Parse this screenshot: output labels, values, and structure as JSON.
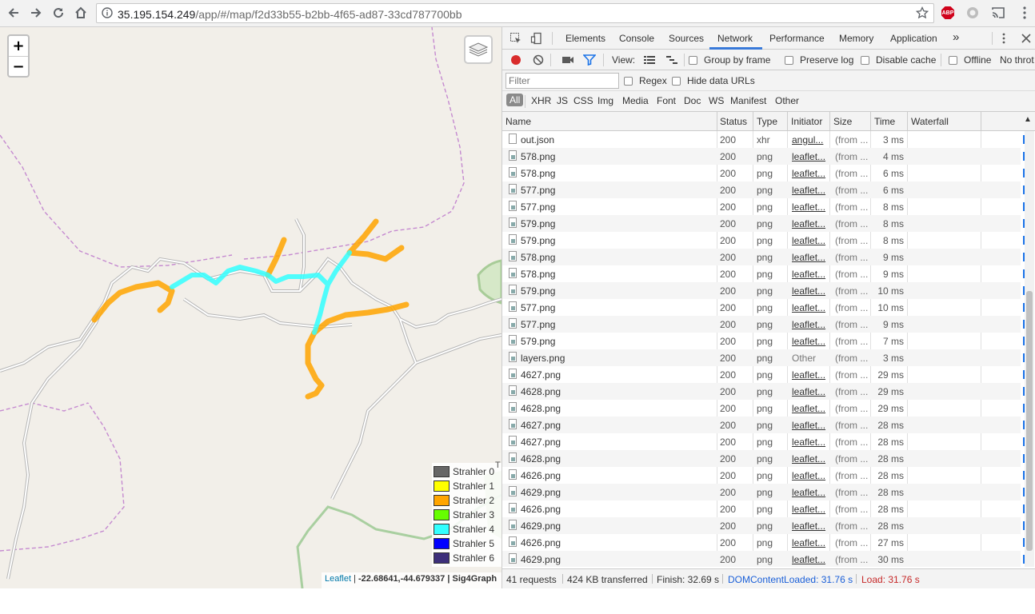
{
  "browser": {
    "url_host": "35.195.154.249",
    "url_path": "/app/#/map/f2d33b55-b2bb-4f65-ad87-33cd787700bb",
    "abp_label": "ABP"
  },
  "map": {
    "zoom_in": "+",
    "zoom_out": "−",
    "legend": [
      {
        "label": "Strahler 0",
        "color": "#666666"
      },
      {
        "label": "Strahler 1",
        "color": "#ffff00"
      },
      {
        "label": "Strahler 2",
        "color": "#ffa500"
      },
      {
        "label": "Strahler 3",
        "color": "#66ff00"
      },
      {
        "label": "Strahler 4",
        "color": "#33ffff"
      },
      {
        "label": "Strahler 5",
        "color": "#0000ff"
      },
      {
        "label": "Strahler 6",
        "color": "#3d2f7a"
      }
    ],
    "edge_label": "T",
    "attribution": {
      "leaflet": "Leaflet",
      "separator": "|",
      "coords": "-22.68641,-44.679337",
      "brand": "Sig4Graph"
    }
  },
  "devtools": {
    "tabs": [
      "Elements",
      "Console",
      "Sources",
      "Network",
      "Performance",
      "Memory",
      "Application"
    ],
    "more_tabs": "»",
    "toolbar": {
      "view_label": "View:",
      "group_by_frame": "Group by frame",
      "preserve_log": "Preserve log",
      "disable_cache": "Disable cache",
      "offline": "Offline",
      "throttle": "No throt"
    },
    "filter": {
      "placeholder": "Filter",
      "regex": "Regex",
      "hide_data_urls": "Hide data URLs"
    },
    "types": [
      "All",
      "XHR",
      "JS",
      "CSS",
      "Img",
      "Media",
      "Font",
      "Doc",
      "WS",
      "Manifest",
      "Other"
    ],
    "columns": [
      "Name",
      "Status",
      "Type",
      "Initiator",
      "Size",
      "Time",
      "Waterfall"
    ],
    "rows": [
      {
        "name": "out.json",
        "status": "200",
        "type": "xhr",
        "initiator": "angul...",
        "size": "(from ...",
        "time": "3 ms",
        "icon": "doc"
      },
      {
        "name": "578.png",
        "status": "200",
        "type": "png",
        "initiator": "leaflet...",
        "size": "(from ...",
        "time": "4 ms",
        "icon": "img"
      },
      {
        "name": "578.png",
        "status": "200",
        "type": "png",
        "initiator": "leaflet...",
        "size": "(from ...",
        "time": "6 ms",
        "icon": "img"
      },
      {
        "name": "577.png",
        "status": "200",
        "type": "png",
        "initiator": "leaflet...",
        "size": "(from ...",
        "time": "6 ms",
        "icon": "img"
      },
      {
        "name": "577.png",
        "status": "200",
        "type": "png",
        "initiator": "leaflet...",
        "size": "(from ...",
        "time": "8 ms",
        "icon": "img"
      },
      {
        "name": "579.png",
        "status": "200",
        "type": "png",
        "initiator": "leaflet...",
        "size": "(from ...",
        "time": "8 ms",
        "icon": "img"
      },
      {
        "name": "579.png",
        "status": "200",
        "type": "png",
        "initiator": "leaflet...",
        "size": "(from ...",
        "time": "8 ms",
        "icon": "img"
      },
      {
        "name": "578.png",
        "status": "200",
        "type": "png",
        "initiator": "leaflet...",
        "size": "(from ...",
        "time": "9 ms",
        "icon": "img"
      },
      {
        "name": "578.png",
        "status": "200",
        "type": "png",
        "initiator": "leaflet...",
        "size": "(from ...",
        "time": "9 ms",
        "icon": "img"
      },
      {
        "name": "579.png",
        "status": "200",
        "type": "png",
        "initiator": "leaflet...",
        "size": "(from ...",
        "time": "10 ms",
        "icon": "img"
      },
      {
        "name": "577.png",
        "status": "200",
        "type": "png",
        "initiator": "leaflet...",
        "size": "(from ...",
        "time": "10 ms",
        "icon": "img"
      },
      {
        "name": "577.png",
        "status": "200",
        "type": "png",
        "initiator": "leaflet...",
        "size": "(from ...",
        "time": "9 ms",
        "icon": "img"
      },
      {
        "name": "579.png",
        "status": "200",
        "type": "png",
        "initiator": "leaflet...",
        "size": "(from ...",
        "time": "7 ms",
        "icon": "img"
      },
      {
        "name": "layers.png",
        "status": "200",
        "type": "png",
        "initiator": "Other",
        "size": "(from ...",
        "time": "3 ms",
        "icon": "img"
      },
      {
        "name": "4627.png",
        "status": "200",
        "type": "png",
        "initiator": "leaflet...",
        "size": "(from ...",
        "time": "29 ms",
        "icon": "img"
      },
      {
        "name": "4628.png",
        "status": "200",
        "type": "png",
        "initiator": "leaflet...",
        "size": "(from ...",
        "time": "29 ms",
        "icon": "img"
      },
      {
        "name": "4628.png",
        "status": "200",
        "type": "png",
        "initiator": "leaflet...",
        "size": "(from ...",
        "time": "29 ms",
        "icon": "img"
      },
      {
        "name": "4627.png",
        "status": "200",
        "type": "png",
        "initiator": "leaflet...",
        "size": "(from ...",
        "time": "28 ms",
        "icon": "img"
      },
      {
        "name": "4627.png",
        "status": "200",
        "type": "png",
        "initiator": "leaflet...",
        "size": "(from ...",
        "time": "28 ms",
        "icon": "img"
      },
      {
        "name": "4628.png",
        "status": "200",
        "type": "png",
        "initiator": "leaflet...",
        "size": "(from ...",
        "time": "28 ms",
        "icon": "img"
      },
      {
        "name": "4626.png",
        "status": "200",
        "type": "png",
        "initiator": "leaflet...",
        "size": "(from ...",
        "time": "28 ms",
        "icon": "img"
      },
      {
        "name": "4629.png",
        "status": "200",
        "type": "png",
        "initiator": "leaflet...",
        "size": "(from ...",
        "time": "28 ms",
        "icon": "img"
      },
      {
        "name": "4626.png",
        "status": "200",
        "type": "png",
        "initiator": "leaflet...",
        "size": "(from ...",
        "time": "28 ms",
        "icon": "img"
      },
      {
        "name": "4629.png",
        "status": "200",
        "type": "png",
        "initiator": "leaflet...",
        "size": "(from ...",
        "time": "28 ms",
        "icon": "img"
      },
      {
        "name": "4626.png",
        "status": "200",
        "type": "png",
        "initiator": "leaflet...",
        "size": "(from ...",
        "time": "27 ms",
        "icon": "img"
      },
      {
        "name": "4629.png",
        "status": "200",
        "type": "png",
        "initiator": "leaflet...",
        "size": "(from ...",
        "time": "30 ms",
        "icon": "img"
      }
    ],
    "status_bar": {
      "requests": "41 requests",
      "transferred": "424 KB transferred",
      "finish": "Finish: 32.69 s",
      "dcl": "DOMContentLoaded: 31.76 s",
      "load": "Load: 31.76 s"
    }
  }
}
